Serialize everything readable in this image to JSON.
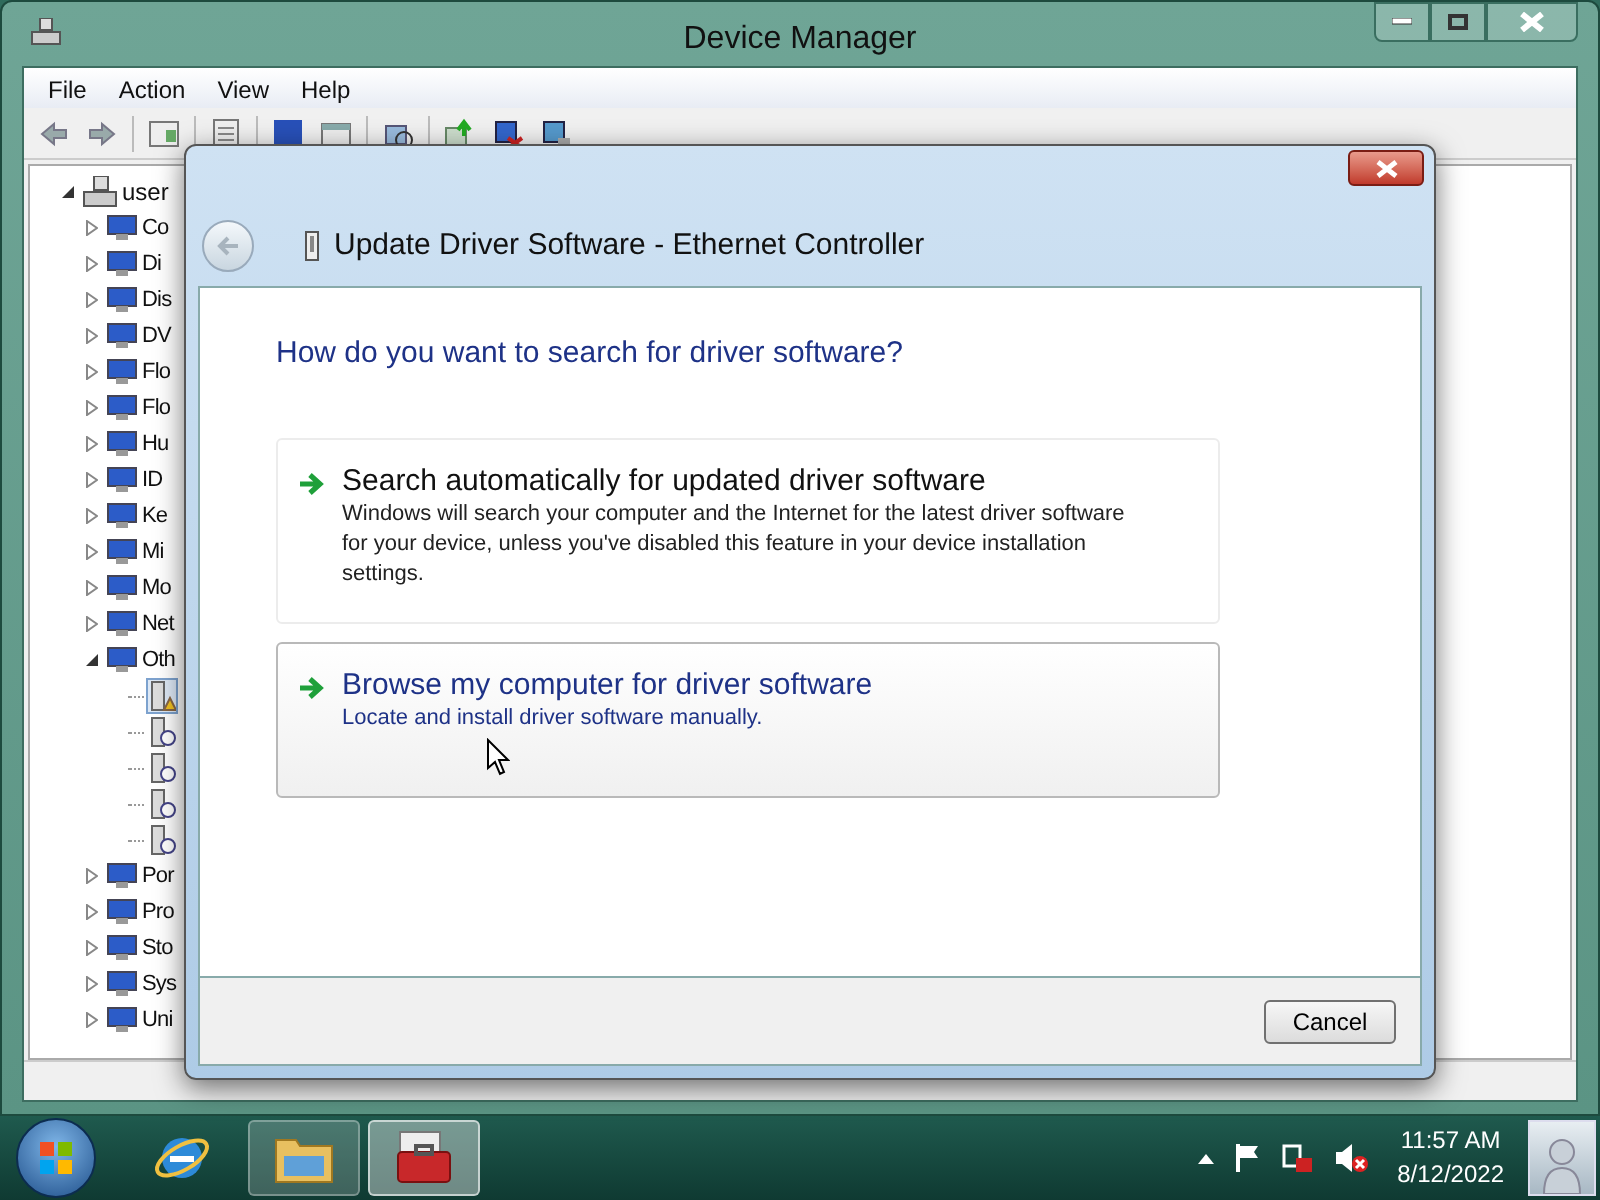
{
  "window": {
    "title": "Device Manager"
  },
  "menu": [
    {
      "label": "File"
    },
    {
      "label": "Action"
    },
    {
      "label": "View"
    },
    {
      "label": "Help"
    }
  ],
  "tree": {
    "label": "user",
    "expanded": true,
    "selected": false,
    "children": [
      {
        "label": "Co",
        "expanded": false,
        "selected": false
      },
      {
        "label": "Di",
        "expanded": false,
        "selected": false
      },
      {
        "label": "Dis",
        "expanded": false,
        "selected": false
      },
      {
        "label": "DV",
        "expanded": false,
        "selected": false
      },
      {
        "label": "Flo",
        "expanded": false,
        "selected": false
      },
      {
        "label": "Flo",
        "expanded": false,
        "selected": false
      },
      {
        "label": "Hu",
        "expanded": false,
        "selected": false
      },
      {
        "label": "ID",
        "expanded": false,
        "selected": false
      },
      {
        "label": "Ke",
        "expanded": false,
        "selected": false
      },
      {
        "label": "Mi",
        "expanded": false,
        "selected": false
      },
      {
        "label": "Mo",
        "expanded": false,
        "selected": false
      },
      {
        "label": "Net",
        "expanded": false,
        "selected": false
      },
      {
        "label": "Oth",
        "expanded": true,
        "selected": false,
        "children": [
          {
            "kind": "warning",
            "selected": true
          },
          {
            "kind": "unknown",
            "selected": false
          },
          {
            "kind": "unknown",
            "selected": false
          },
          {
            "kind": "unknown",
            "selected": false
          },
          {
            "kind": "unknown",
            "selected": false
          }
        ]
      },
      {
        "label": "Por",
        "expanded": false,
        "selected": false
      },
      {
        "label": "Pro",
        "expanded": false,
        "selected": false
      },
      {
        "label": "Sto",
        "expanded": false,
        "selected": false
      },
      {
        "label": "Sys",
        "expanded": false,
        "selected": false
      },
      {
        "label": "Uni",
        "expanded": false,
        "selected": false
      }
    ]
  },
  "dialog": {
    "title": "Update Driver Software - Ethernet Controller",
    "heading": "How do you want to search for driver software?",
    "options": [
      {
        "title": "Search automatically for updated driver software",
        "description": "Windows will search your computer and the Internet for the latest driver software for your device, unless you've disabled this feature in your device installation settings.",
        "hovered": false
      },
      {
        "title": "Browse my computer for driver software",
        "description": "Locate and install driver software manually.",
        "hovered": true
      }
    ],
    "buttons": [
      "Cancel"
    ]
  },
  "taskbar": {
    "apps": [
      {
        "kind": "browser",
        "selected": false
      },
      {
        "kind": "folder",
        "selected": false
      },
      {
        "kind": "toolbox",
        "selected": true
      }
    ],
    "time": "11:57 AM",
    "date": "8/12/2022"
  }
}
